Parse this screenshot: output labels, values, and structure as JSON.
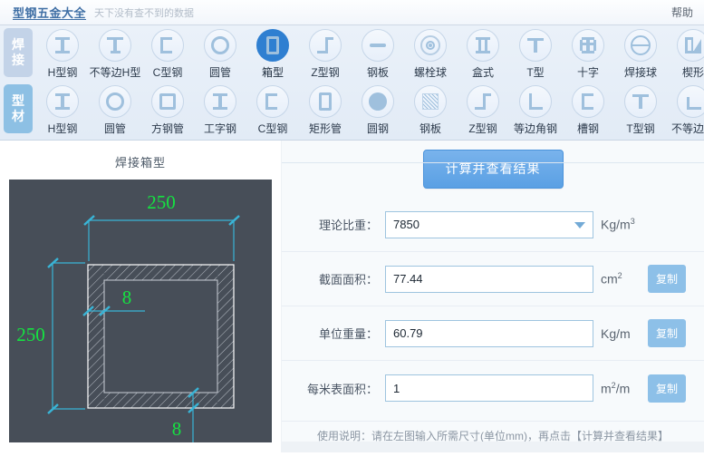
{
  "header": {
    "brand": "型钢五金大全",
    "tagline": "天下没有查不到的数据",
    "help": "帮助"
  },
  "tabs": {
    "rows": [
      {
        "category": "焊接",
        "active": false,
        "items": [
          {
            "label": "H型钢",
            "icon": "i-beam-icon",
            "selected": false
          },
          {
            "label": "不等边H型",
            "icon": "unequal-i-beam-icon",
            "selected": false
          },
          {
            "label": "C型钢",
            "icon": "c-channel-icon",
            "selected": false
          },
          {
            "label": "圆管",
            "icon": "round-tube-icon",
            "selected": false
          },
          {
            "label": "箱型",
            "icon": "box-section-icon",
            "selected": true
          },
          {
            "label": "Z型钢",
            "icon": "z-beam-icon",
            "selected": false
          },
          {
            "label": "钢板",
            "icon": "steel-plate-bar-icon",
            "selected": false
          },
          {
            "label": "螺栓球",
            "icon": "bolt-ball-icon",
            "selected": false
          },
          {
            "label": "盒式",
            "icon": "box-double-icon",
            "selected": false
          },
          {
            "label": "T型",
            "icon": "t-beam-icon",
            "selected": false
          },
          {
            "label": "十字",
            "icon": "cross-section-icon",
            "selected": false
          },
          {
            "label": "焊接球",
            "icon": "welded-ball-icon",
            "selected": false
          },
          {
            "label": "楔形",
            "icon": "wedge-icon",
            "selected": false
          }
        ]
      },
      {
        "category": "型材",
        "active": true,
        "items": [
          {
            "label": "H型钢",
            "icon": "i-beam-icon",
            "selected": false
          },
          {
            "label": "圆管",
            "icon": "round-tube-icon",
            "selected": false
          },
          {
            "label": "方钢管",
            "icon": "square-tube-icon",
            "selected": false
          },
          {
            "label": "工字钢",
            "icon": "i-beam-icon",
            "selected": false
          },
          {
            "label": "C型钢",
            "icon": "c-channel-icon",
            "selected": false
          },
          {
            "label": "矩形管",
            "icon": "rect-tube-icon",
            "selected": false
          },
          {
            "label": "圆钢",
            "icon": "round-bar-icon",
            "selected": false
          },
          {
            "label": "钢板",
            "icon": "steel-plate-icon",
            "selected": false
          },
          {
            "label": "Z型钢",
            "icon": "z-beam-icon",
            "selected": false
          },
          {
            "label": "等边角钢",
            "icon": "equal-angle-icon",
            "selected": false
          },
          {
            "label": "槽钢",
            "icon": "channel-icon",
            "selected": false
          },
          {
            "label": "T型钢",
            "icon": "t-beam-icon",
            "selected": false
          },
          {
            "label": "不等边角",
            "icon": "unequal-angle-icon",
            "selected": false
          }
        ]
      }
    ]
  },
  "figure": {
    "title": "焊接箱型",
    "width_label": "250",
    "height_label": "250",
    "thickness_top_label": "8",
    "thickness_bottom_label": "8",
    "background_color": "#474e58",
    "dimension_color": "#39b4d6",
    "text_color": "#15e341"
  },
  "panel": {
    "calculate_button": "计算并查看结果",
    "copy_label": "复制",
    "hint": "使用说明：请在左图输入所需尺寸(单位mm)，再点击【计算并查看结果】",
    "fields": [
      {
        "label": "理论比重：",
        "value": "7850",
        "unit": "Kg/m",
        "unit_sup": "3",
        "type": "select",
        "has_copy": false
      },
      {
        "label": "截面面积：",
        "value": "77.44",
        "unit": "cm",
        "unit_sup": "2",
        "type": "text",
        "has_copy": true
      },
      {
        "label": "单位重量：",
        "value": "60.79",
        "unit": "Kg/m",
        "unit_sup": "",
        "type": "text",
        "has_copy": true
      },
      {
        "label": "每米表面积：",
        "value": "1",
        "unit_pre": "m",
        "unit_sup": "2",
        "unit_post": "/m",
        "unit": "m/m",
        "type": "text",
        "has_copy": true
      }
    ]
  },
  "colors": {
    "accent": "#5aa0e4",
    "copy_button": "#8dc0e8",
    "tab_bg": "#e6eef8",
    "selected_tab": "#2f7fd1"
  }
}
